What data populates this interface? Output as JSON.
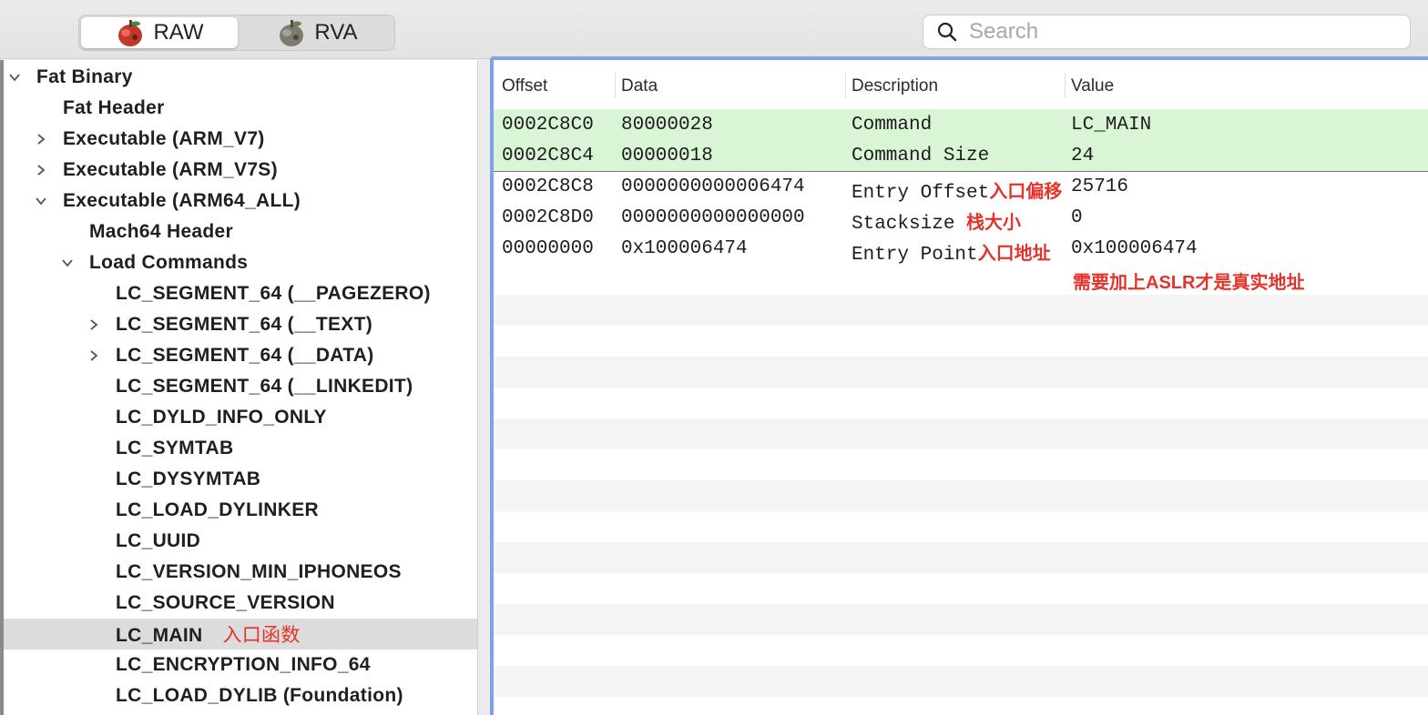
{
  "toolbar": {
    "raw_label": "RAW",
    "rva_label": "RVA",
    "search_placeholder": "Search"
  },
  "sidebar": {
    "items": [
      {
        "label": "Fat Binary",
        "indent": 0,
        "disclosure": "expanded"
      },
      {
        "label": "Fat Header",
        "indent": 1,
        "disclosure": "none"
      },
      {
        "label": "Executable  (ARM_V7)",
        "indent": 1,
        "disclosure": "collapsed"
      },
      {
        "label": "Executable  (ARM_V7S)",
        "indent": 1,
        "disclosure": "collapsed"
      },
      {
        "label": "Executable  (ARM64_ALL)",
        "indent": 1,
        "disclosure": "expanded"
      },
      {
        "label": "Mach64 Header",
        "indent": 2,
        "disclosure": "none"
      },
      {
        "label": "Load Commands",
        "indent": 2,
        "disclosure": "expanded"
      },
      {
        "label": "LC_SEGMENT_64 (__PAGEZERO)",
        "indent": 3,
        "disclosure": "none"
      },
      {
        "label": "LC_SEGMENT_64 (__TEXT)",
        "indent": 3,
        "disclosure": "collapsed"
      },
      {
        "label": "LC_SEGMENT_64 (__DATA)",
        "indent": 3,
        "disclosure": "collapsed"
      },
      {
        "label": "LC_SEGMENT_64 (__LINKEDIT)",
        "indent": 3,
        "disclosure": "none"
      },
      {
        "label": "LC_DYLD_INFO_ONLY",
        "indent": 3,
        "disclosure": "none"
      },
      {
        "label": "LC_SYMTAB",
        "indent": 3,
        "disclosure": "none"
      },
      {
        "label": "LC_DYSYMTAB",
        "indent": 3,
        "disclosure": "none"
      },
      {
        "label": "LC_LOAD_DYLINKER",
        "indent": 3,
        "disclosure": "none"
      },
      {
        "label": "LC_UUID",
        "indent": 3,
        "disclosure": "none"
      },
      {
        "label": "LC_VERSION_MIN_IPHONEOS",
        "indent": 3,
        "disclosure": "none"
      },
      {
        "label": "LC_SOURCE_VERSION",
        "indent": 3,
        "disclosure": "none"
      },
      {
        "label": "LC_MAIN",
        "indent": 3,
        "disclosure": "none",
        "selected": true,
        "annotation": "入口函数"
      },
      {
        "label": "LC_ENCRYPTION_INFO_64",
        "indent": 3,
        "disclosure": "none"
      },
      {
        "label": "LC_LOAD_DYLIB (Foundation)",
        "indent": 3,
        "disclosure": "none"
      }
    ]
  },
  "table": {
    "headers": [
      "Offset",
      "Data",
      "Description",
      "Value"
    ],
    "rows": [
      {
        "offset": "0002C8C0",
        "data": "80000028",
        "description": "Command",
        "value": "LC_MAIN",
        "highlight": true
      },
      {
        "offset": "0002C8C4",
        "data": "00000018",
        "description": "Command Size",
        "value": "24",
        "highlight": true
      },
      {
        "offset": "0002C8C8",
        "data": "0000000000006474",
        "description": "Entry Offset",
        "annotation": "入口偏移",
        "value": "25716"
      },
      {
        "offset": "0002C8D0",
        "data": "0000000000000000",
        "description": "Stacksize ",
        "annotation": "栈大小",
        "value": "0"
      },
      {
        "offset": "00000000",
        "data": "0x100006474",
        "description": "Entry Point",
        "annotation": "入口地址",
        "value": "0x100006474"
      }
    ],
    "note": "需要加上ASLR才是真实地址"
  },
  "colors": {
    "highlight_row": "#d9f5d5",
    "annotation": "#e4332a",
    "focus_border": "#7fa2e6"
  }
}
